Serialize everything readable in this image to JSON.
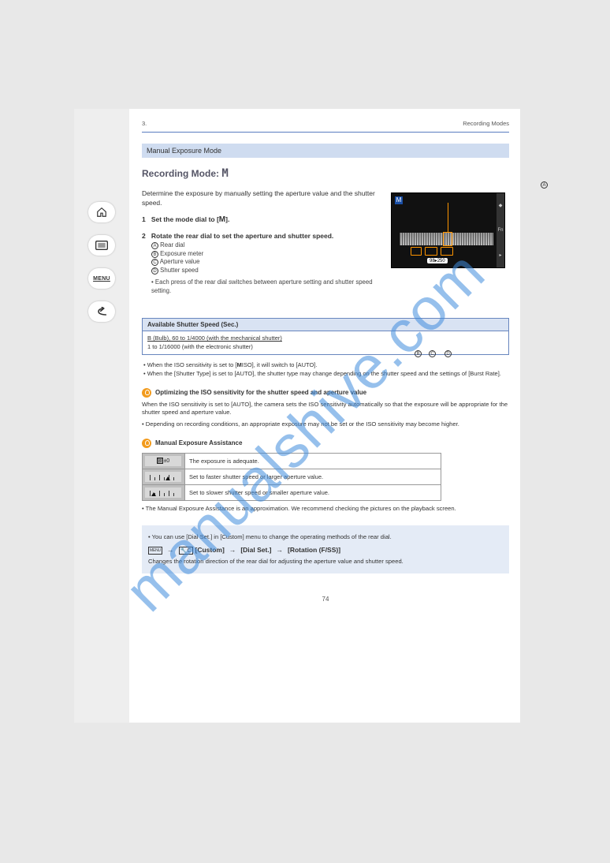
{
  "header": {
    "section_num": "3.",
    "section_title": "Recording Modes"
  },
  "band_title": "Manual Exposure Mode",
  "main_title_pre": "Recording Mode: ",
  "main_title_icon": "M",
  "intro": "Determine the exposure by manually setting the aperture value and the shutter speed.",
  "steps": {
    "s1_num": "1",
    "s1_text": "Set the mode dial to [",
    "s1_text2": "].",
    "s2_num": "2",
    "s2_text": "Rotate the rear dial to set the aperture and shutter speed.",
    "s2_sub_a": "Rear dial",
    "s2_sub_b": "Exposure meter",
    "s2_sub_c": "Aperture value",
    "s2_sub_d": "Shutter speed",
    "s2_line": "Each press of the rear dial switches between aperture setting and shutter speed setting."
  },
  "labels": {
    "A": "A",
    "B": "B",
    "C": "C",
    "D": "D"
  },
  "avail": {
    "head": "Available Shutter Speed (Sec.)",
    "body_a": "B (Bulb), 60 to 1/4000 (with the mechanical shutter)",
    "body_b": "1 to 1/16000 (with the electronic shutter)"
  },
  "note_bullets": {
    "n1": "When the ISO sensitivity is set to [",
    "n1b": "ISO], it will switch to [AUTO].",
    "n2": "When the [Shutter Type] is set to [AUTO], the shutter type may change depending on the shutter speed and the settings of [Burst Rate]."
  },
  "tip1": {
    "title": "Optimizing the ISO sensitivity for the shutter speed and aperture value",
    "body": "When the ISO sensitivity is set to [AUTO], the camera sets the ISO sensitivity automatically so that the exposure will be appropriate for the shutter speed and aperture value.",
    "body2": "Depending on recording conditions, an appropriate exposure may not be set or the ISO sensitivity may become higher."
  },
  "tip2": {
    "title": "Manual Exposure Assistance"
  },
  "table": {
    "r1": "The exposure is adequate.",
    "r2": "Set to faster shutter speed or larger aperture value.",
    "r3": "Set to slower shutter speed or smaller aperture value."
  },
  "table_footnote": "The Manual Exposure Assistance is an approximation. We recommend checking the pictures on the playback screen.",
  "menupath": {
    "pre": "You can use [Dial Set.] in [Custom] menu to change the operating methods of the rear dial.",
    "lead": "",
    "m2": "[Custom]",
    "m3": "[Dial Set.]",
    "m4": "[Rotation (F/SS)]",
    "tail": "Changes the rotation direction of the rear dial for adjusting the aperture value and shutter speed."
  },
  "page_number": "74",
  "screen": {
    "ssval": "250"
  },
  "axlabel": "±0"
}
